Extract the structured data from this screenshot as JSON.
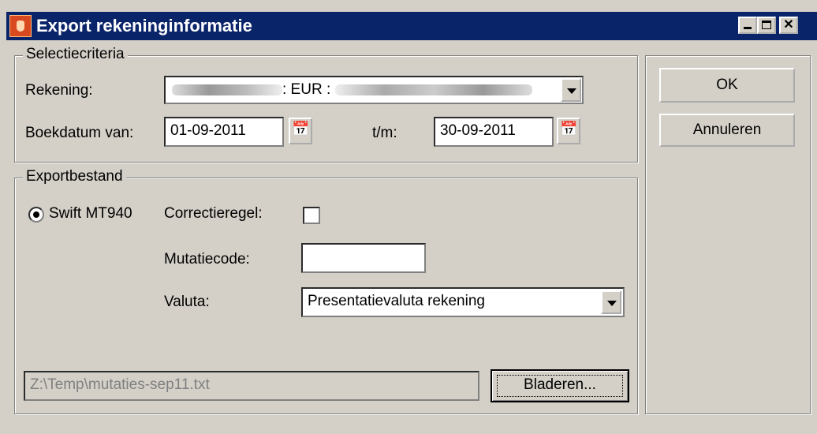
{
  "window": {
    "title": "Export rekeninginformatie"
  },
  "selectie": {
    "group_label": "Selectiecriteria",
    "rekening_label": "Rekening:",
    "rekening_value": ": EUR :",
    "boekdatum_label": "Boekdatum van:",
    "date_from": "01-09-2011",
    "tm_label": "t/m:",
    "date_to": "30-09-2011"
  },
  "export": {
    "group_label": "Exportbestand",
    "format_label": "Swift MT940",
    "correctieregel_label": "Correctieregel:",
    "mutatiecode_label": "Mutatiecode:",
    "mutatiecode_value": "",
    "valuta_label": "Valuta:",
    "valuta_value": "Presentatievaluta rekening",
    "file_path": "Z:\\Temp\\mutaties-sep11.txt",
    "browse_label": "Bladeren..."
  },
  "buttons": {
    "ok": "OK",
    "cancel": "Annuleren"
  },
  "icons": {
    "app": "app-shield-icon",
    "calendar": "calendar-icon"
  }
}
